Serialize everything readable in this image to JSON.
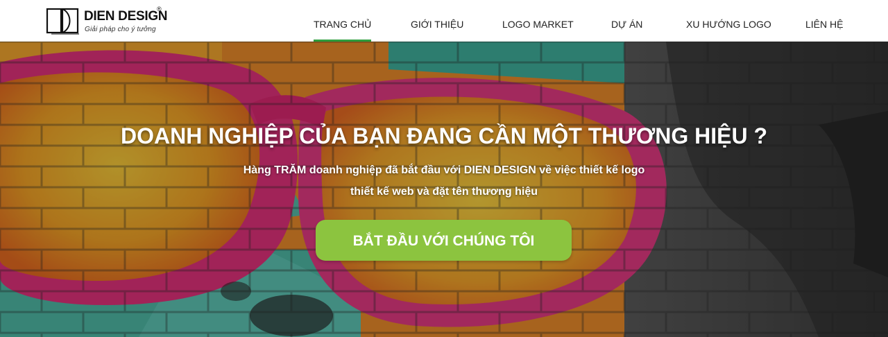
{
  "header": {
    "brand": {
      "name": "DIEN DESIGN",
      "reg": "®",
      "tagline": "Giải pháp cho ý tưởng"
    },
    "nav": [
      {
        "label": "TRANG CHỦ",
        "active": true
      },
      {
        "label": "GIỚI THIỆU",
        "active": false
      },
      {
        "label": "LOGO MARKET",
        "active": false
      },
      {
        "label": "DỰ ÁN",
        "active": false
      },
      {
        "label": "XU HƯỚNG LOGO",
        "active": false
      },
      {
        "label": "LIÊN HỆ",
        "active": false
      }
    ],
    "active_color": "#2e9e3e"
  },
  "hero": {
    "title": "DOANH NGHIỆP CỦA BẠN ĐANG CẦN MỘT THƯƠNG HIỆU ?",
    "subtitle_line1": "Hàng TRĂM doanh nghiệp đã bắt đầu với DIEN DESIGN về việc thiết kế logo",
    "subtitle_line2": "thiết kế web và đặt tên thương hiệu",
    "cta_label": "BẮT ĐẦU VỚI CHÚNG TÔI",
    "cta_color": "#8cc43f",
    "background": "graffiti-wall-pink-sunglasses-image"
  }
}
